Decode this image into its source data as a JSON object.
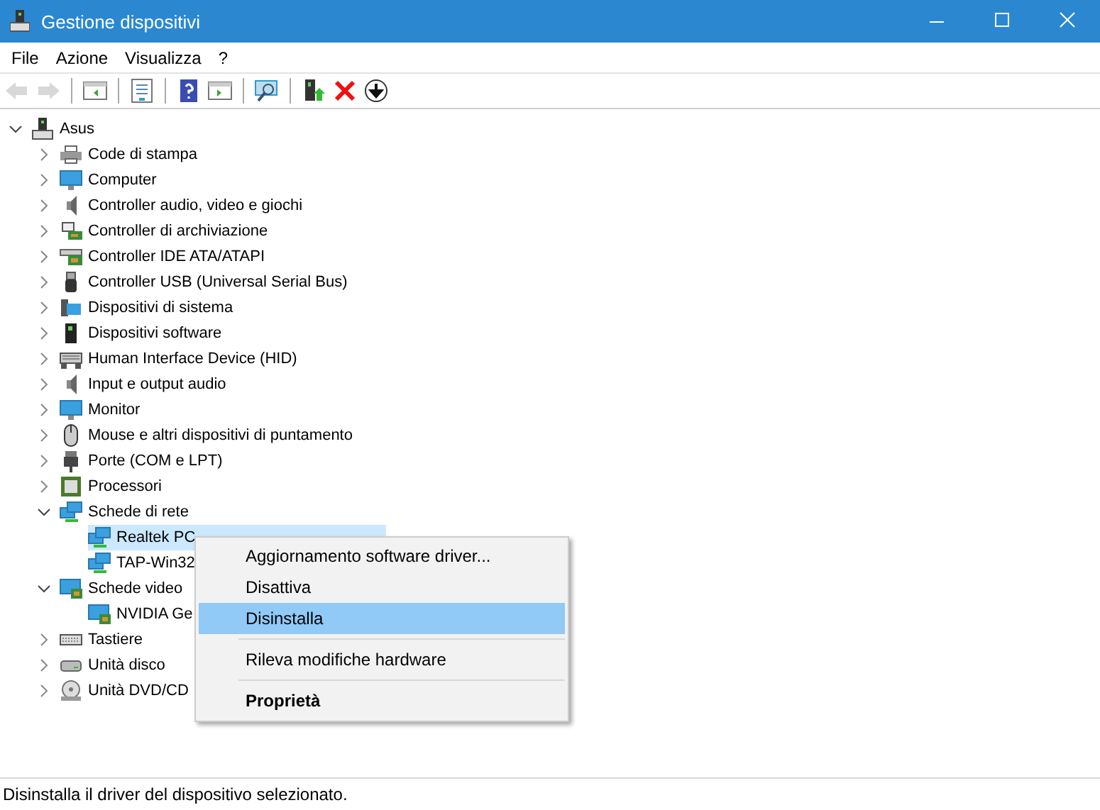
{
  "window": {
    "title": "Gestione dispositivi"
  },
  "menu_bar": [
    "File",
    "Azione",
    "Visualizza",
    "?"
  ],
  "toolbar": [
    {
      "disabled": true
    },
    {
      "disabled": true
    },
    {
      "disabled": false
    },
    {
      "disabled": false
    },
    {
      "disabled": false
    },
    {
      "disabled": false
    },
    {
      "disabled": false
    },
    {
      "disabled": false
    },
    {
      "disabled": false
    },
    {
      "disabled": false
    }
  ],
  "tree": {
    "label": "Asus",
    "expanded": true,
    "children": [
      {
        "label": "Code di stampa",
        "expanded": false
      },
      {
        "label": "Computer",
        "expanded": false
      },
      {
        "label": "Controller audio, video e giochi",
        "expanded": false
      },
      {
        "label": "Controller di archiviazione",
        "expanded": false
      },
      {
        "label": "Controller IDE ATA/ATAPI",
        "expanded": false
      },
      {
        "label": "Controller USB (Universal Serial Bus)",
        "expanded": false
      },
      {
        "label": "Dispositivi di sistema",
        "expanded": false
      },
      {
        "label": "Dispositivi software",
        "expanded": false
      },
      {
        "label": "Human Interface Device (HID)",
        "expanded": false
      },
      {
        "label": "Input e output audio",
        "expanded": false
      },
      {
        "label": "Monitor",
        "expanded": false
      },
      {
        "label": "Mouse e altri dispositivi di puntamento",
        "expanded": false
      },
      {
        "label": "Porte (COM e LPT)",
        "expanded": false
      },
      {
        "label": "Processori",
        "expanded": false
      },
      {
        "label": "Schede di rete",
        "expanded": true,
        "children": [
          {
            "label": "Realtek PC",
            "selected": true
          },
          {
            "label": "TAP-Win32",
            "selected": false
          }
        ]
      },
      {
        "label": "Schede video",
        "expanded": true,
        "children": [
          {
            "label": "NVIDIA Ge",
            "selected": false
          }
        ]
      },
      {
        "label": "Tastiere",
        "expanded": false
      },
      {
        "label": "Unità disco",
        "expanded": false
      },
      {
        "label": "Unità DVD/CD",
        "expanded": false
      }
    ]
  },
  "context_menu": {
    "items": [
      {
        "label": "Aggiornamento software driver...",
        "selected": false,
        "bold": false,
        "separator_before": false
      },
      {
        "label": "Disattiva",
        "selected": false,
        "bold": false,
        "separator_before": false
      },
      {
        "label": "Disinstalla",
        "selected": true,
        "bold": false,
        "separator_before": false
      },
      {
        "label": "Rileva modifiche hardware",
        "selected": false,
        "bold": false,
        "separator_before": true
      },
      {
        "label": "Proprietà",
        "selected": false,
        "bold": true,
        "separator_before": true
      }
    ]
  },
  "status_bar": "Disinstalla il driver del dispositivo selezionato."
}
